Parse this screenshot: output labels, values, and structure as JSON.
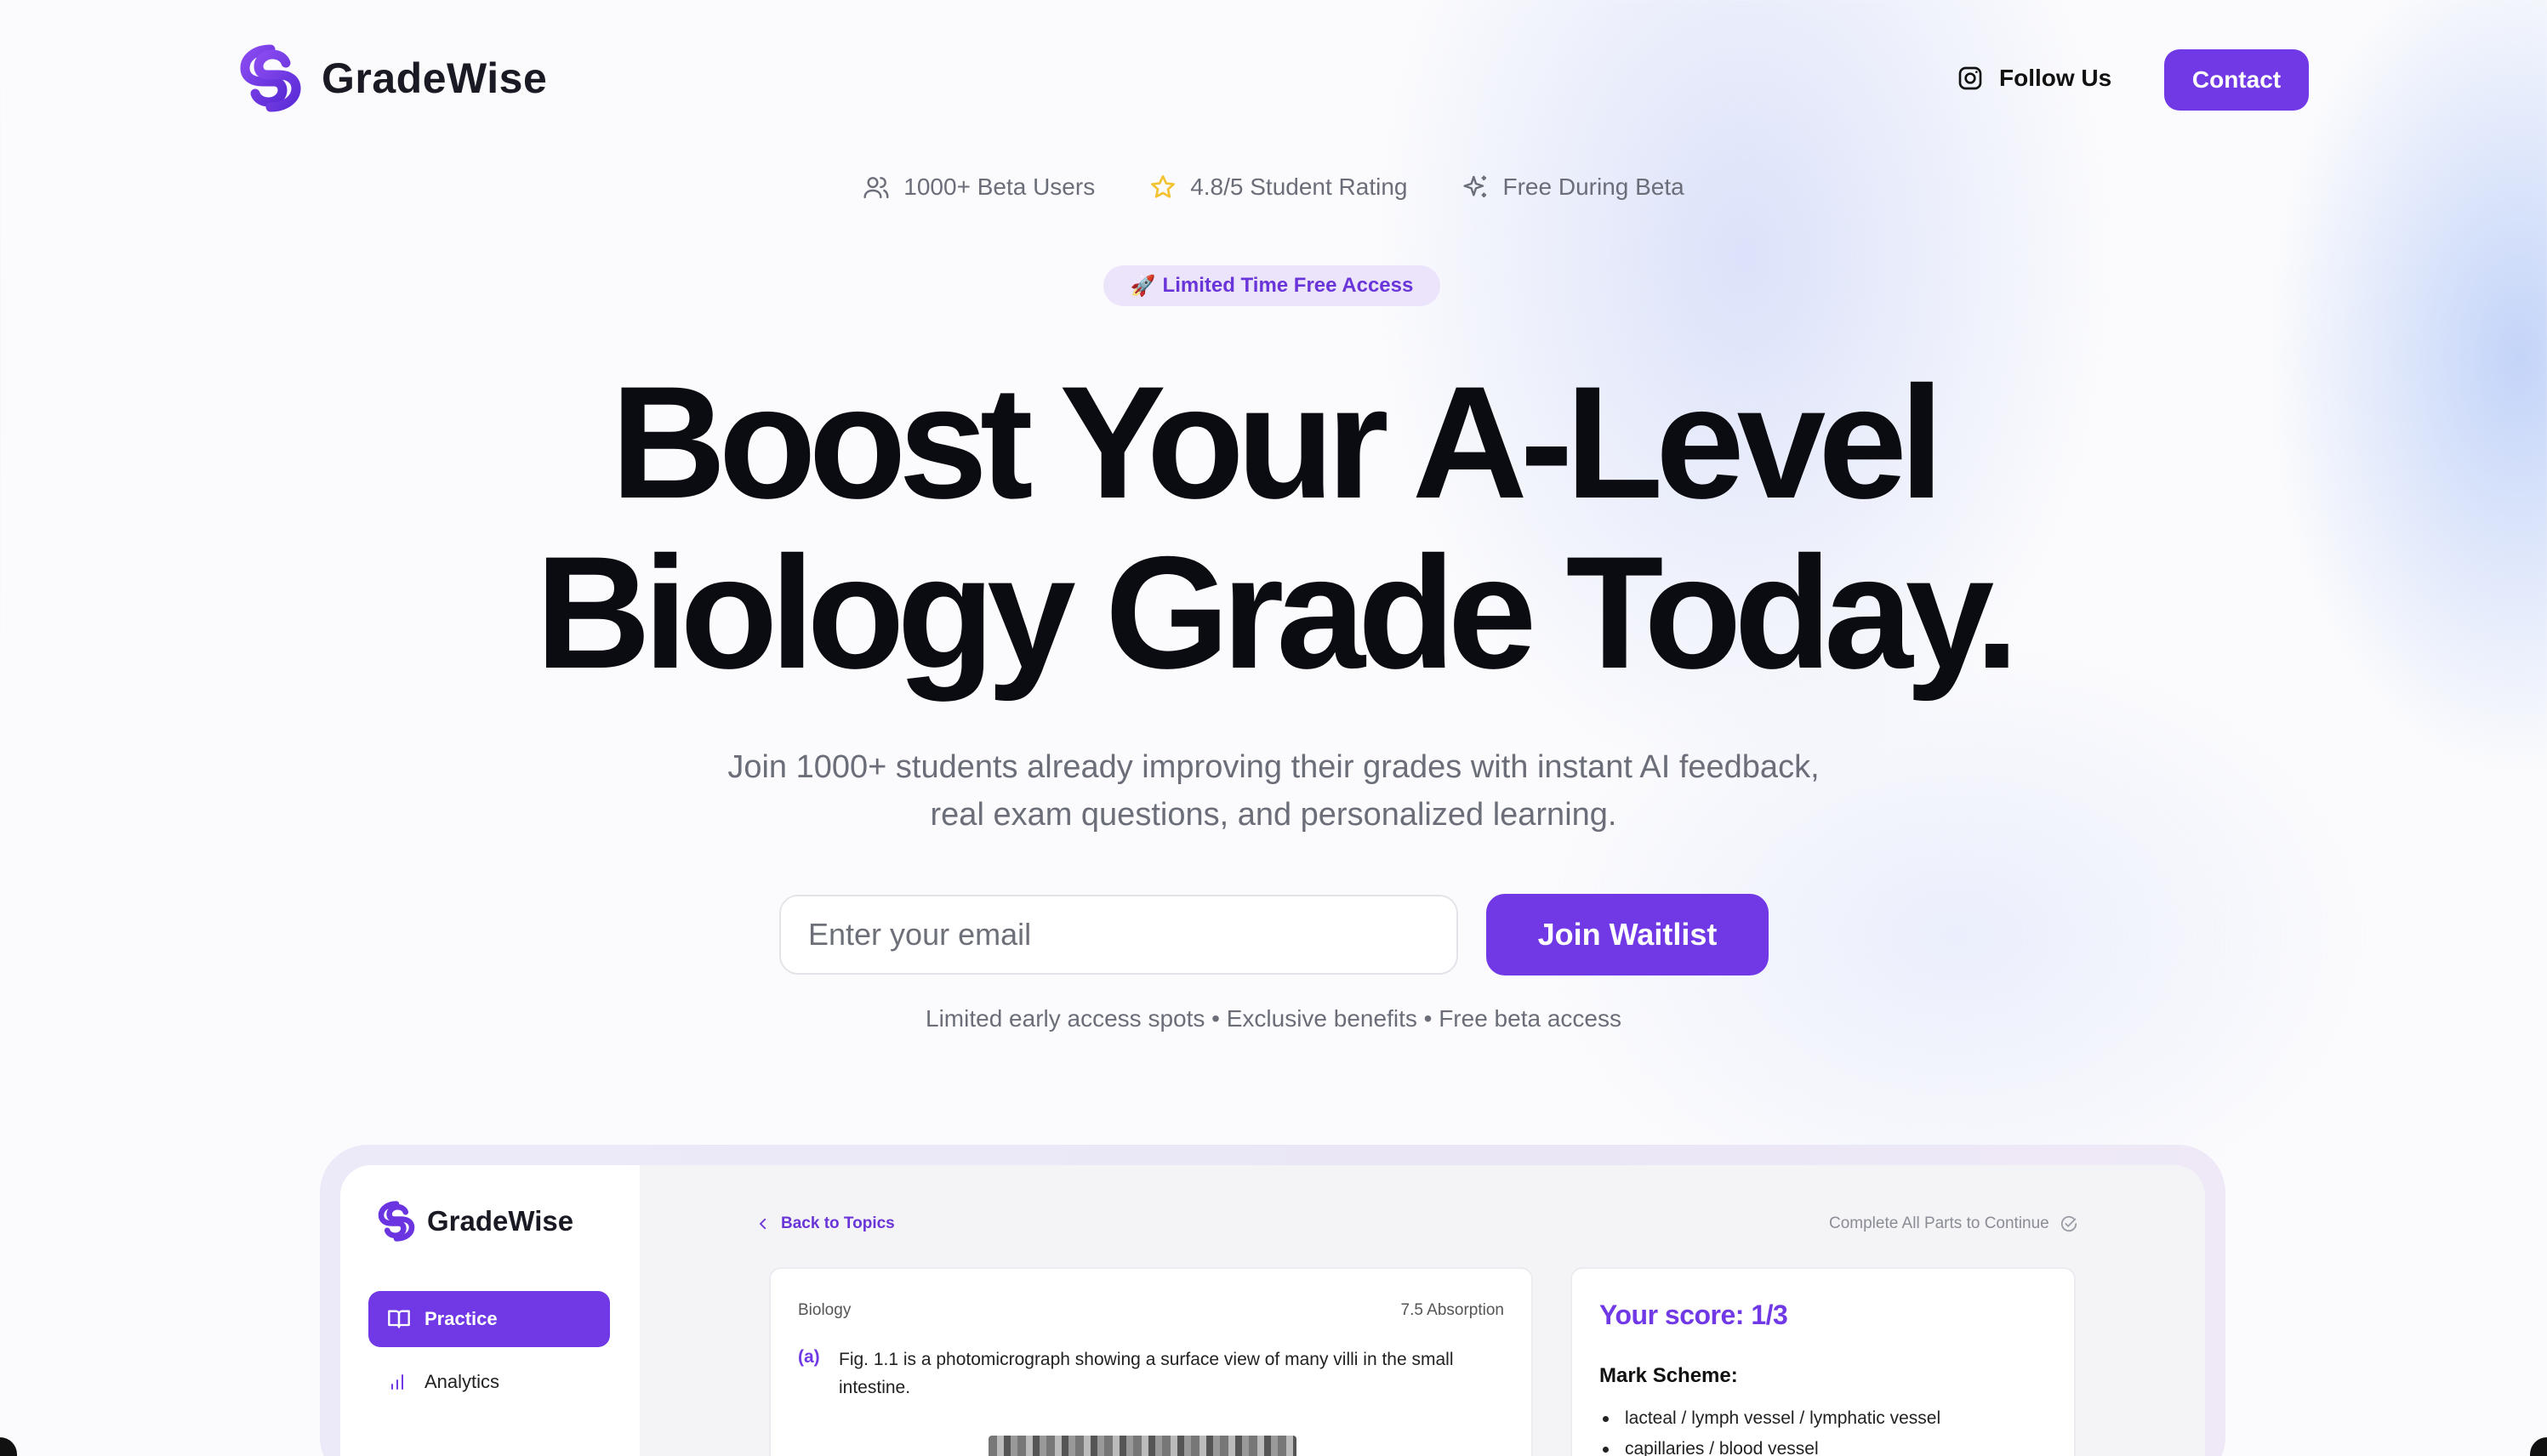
{
  "header": {
    "brand": "GradeWise",
    "follow_label": "Follow Us",
    "contact_label": "Contact"
  },
  "stats": [
    {
      "icon": "users-icon",
      "label": "1000+ Beta Users"
    },
    {
      "icon": "star-icon",
      "label": "4.8/5 Student Rating"
    },
    {
      "icon": "sparkle-icon",
      "label": "Free During Beta"
    }
  ],
  "badge": {
    "emoji": "🚀",
    "label": "Limited Time Free Access"
  },
  "hero": {
    "line1": "Boost Your A-Level",
    "line2": "Biology Grade Today.",
    "subtitle_line1": "Join 1000+ students already improving their grades with instant AI feedback,",
    "subtitle_line2": "real exam questions, and personalized learning."
  },
  "signup": {
    "email_placeholder": "Enter your email",
    "join_label": "Join Waitlist",
    "perks": "Limited early access spots • Exclusive benefits • Free beta access"
  },
  "preview": {
    "brand": "GradeWise",
    "nav": [
      {
        "label": "Practice",
        "active": true,
        "icon": "book-icon"
      },
      {
        "label": "Analytics",
        "active": false,
        "icon": "bar-chart-icon"
      }
    ],
    "back_label": "Back to Topics",
    "complete_label": "Complete All Parts to Continue",
    "question": {
      "subject": "Biology",
      "topic": "7.5 Absorption",
      "part": "(a)",
      "text": "Fig. 1.1 is a photomicrograph showing a surface view of many villi in the small intestine."
    },
    "score": {
      "label": "Your score: 1/3",
      "mark_scheme_heading": "Mark Scheme:",
      "items": [
        "lacteal / lymph vessel / lymphatic vessel",
        "capillaries / blood vessel"
      ]
    }
  },
  "colors": {
    "accent": "#7139e6",
    "badge_bg": "#ece4fb",
    "muted_text": "#6b6e79",
    "star": "#f2c230"
  }
}
